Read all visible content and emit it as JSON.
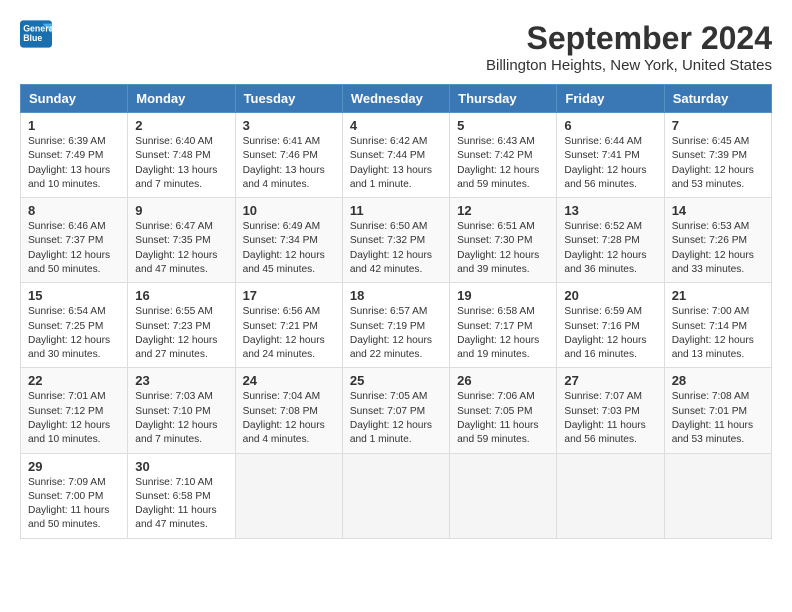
{
  "header": {
    "logo_line1": "General",
    "logo_line2": "Blue",
    "title": "September 2024",
    "subtitle": "Billington Heights, New York, United States"
  },
  "days_of_week": [
    "Sunday",
    "Monday",
    "Tuesday",
    "Wednesday",
    "Thursday",
    "Friday",
    "Saturday"
  ],
  "weeks": [
    [
      {
        "day": 1,
        "sunrise": "6:39 AM",
        "sunset": "7:49 PM",
        "daylight": "13 hours and 10 minutes."
      },
      {
        "day": 2,
        "sunrise": "6:40 AM",
        "sunset": "7:48 PM",
        "daylight": "13 hours and 7 minutes."
      },
      {
        "day": 3,
        "sunrise": "6:41 AM",
        "sunset": "7:46 PM",
        "daylight": "13 hours and 4 minutes."
      },
      {
        "day": 4,
        "sunrise": "6:42 AM",
        "sunset": "7:44 PM",
        "daylight": "13 hours and 1 minute."
      },
      {
        "day": 5,
        "sunrise": "6:43 AM",
        "sunset": "7:42 PM",
        "daylight": "12 hours and 59 minutes."
      },
      {
        "day": 6,
        "sunrise": "6:44 AM",
        "sunset": "7:41 PM",
        "daylight": "12 hours and 56 minutes."
      },
      {
        "day": 7,
        "sunrise": "6:45 AM",
        "sunset": "7:39 PM",
        "daylight": "12 hours and 53 minutes."
      }
    ],
    [
      {
        "day": 8,
        "sunrise": "6:46 AM",
        "sunset": "7:37 PM",
        "daylight": "12 hours and 50 minutes."
      },
      {
        "day": 9,
        "sunrise": "6:47 AM",
        "sunset": "7:35 PM",
        "daylight": "12 hours and 47 minutes."
      },
      {
        "day": 10,
        "sunrise": "6:49 AM",
        "sunset": "7:34 PM",
        "daylight": "12 hours and 45 minutes."
      },
      {
        "day": 11,
        "sunrise": "6:50 AM",
        "sunset": "7:32 PM",
        "daylight": "12 hours and 42 minutes."
      },
      {
        "day": 12,
        "sunrise": "6:51 AM",
        "sunset": "7:30 PM",
        "daylight": "12 hours and 39 minutes."
      },
      {
        "day": 13,
        "sunrise": "6:52 AM",
        "sunset": "7:28 PM",
        "daylight": "12 hours and 36 minutes."
      },
      {
        "day": 14,
        "sunrise": "6:53 AM",
        "sunset": "7:26 PM",
        "daylight": "12 hours and 33 minutes."
      }
    ],
    [
      {
        "day": 15,
        "sunrise": "6:54 AM",
        "sunset": "7:25 PM",
        "daylight": "12 hours and 30 minutes."
      },
      {
        "day": 16,
        "sunrise": "6:55 AM",
        "sunset": "7:23 PM",
        "daylight": "12 hours and 27 minutes."
      },
      {
        "day": 17,
        "sunrise": "6:56 AM",
        "sunset": "7:21 PM",
        "daylight": "12 hours and 24 minutes."
      },
      {
        "day": 18,
        "sunrise": "6:57 AM",
        "sunset": "7:19 PM",
        "daylight": "12 hours and 22 minutes."
      },
      {
        "day": 19,
        "sunrise": "6:58 AM",
        "sunset": "7:17 PM",
        "daylight": "12 hours and 19 minutes."
      },
      {
        "day": 20,
        "sunrise": "6:59 AM",
        "sunset": "7:16 PM",
        "daylight": "12 hours and 16 minutes."
      },
      {
        "day": 21,
        "sunrise": "7:00 AM",
        "sunset": "7:14 PM",
        "daylight": "12 hours and 13 minutes."
      }
    ],
    [
      {
        "day": 22,
        "sunrise": "7:01 AM",
        "sunset": "7:12 PM",
        "daylight": "12 hours and 10 minutes."
      },
      {
        "day": 23,
        "sunrise": "7:03 AM",
        "sunset": "7:10 PM",
        "daylight": "12 hours and 7 minutes."
      },
      {
        "day": 24,
        "sunrise": "7:04 AM",
        "sunset": "7:08 PM",
        "daylight": "12 hours and 4 minutes."
      },
      {
        "day": 25,
        "sunrise": "7:05 AM",
        "sunset": "7:07 PM",
        "daylight": "12 hours and 1 minute."
      },
      {
        "day": 26,
        "sunrise": "7:06 AM",
        "sunset": "7:05 PM",
        "daylight": "11 hours and 59 minutes."
      },
      {
        "day": 27,
        "sunrise": "7:07 AM",
        "sunset": "7:03 PM",
        "daylight": "11 hours and 56 minutes."
      },
      {
        "day": 28,
        "sunrise": "7:08 AM",
        "sunset": "7:01 PM",
        "daylight": "11 hours and 53 minutes."
      }
    ],
    [
      {
        "day": 29,
        "sunrise": "7:09 AM",
        "sunset": "7:00 PM",
        "daylight": "11 hours and 50 minutes."
      },
      {
        "day": 30,
        "sunrise": "7:10 AM",
        "sunset": "6:58 PM",
        "daylight": "11 hours and 47 minutes."
      },
      null,
      null,
      null,
      null,
      null
    ]
  ]
}
